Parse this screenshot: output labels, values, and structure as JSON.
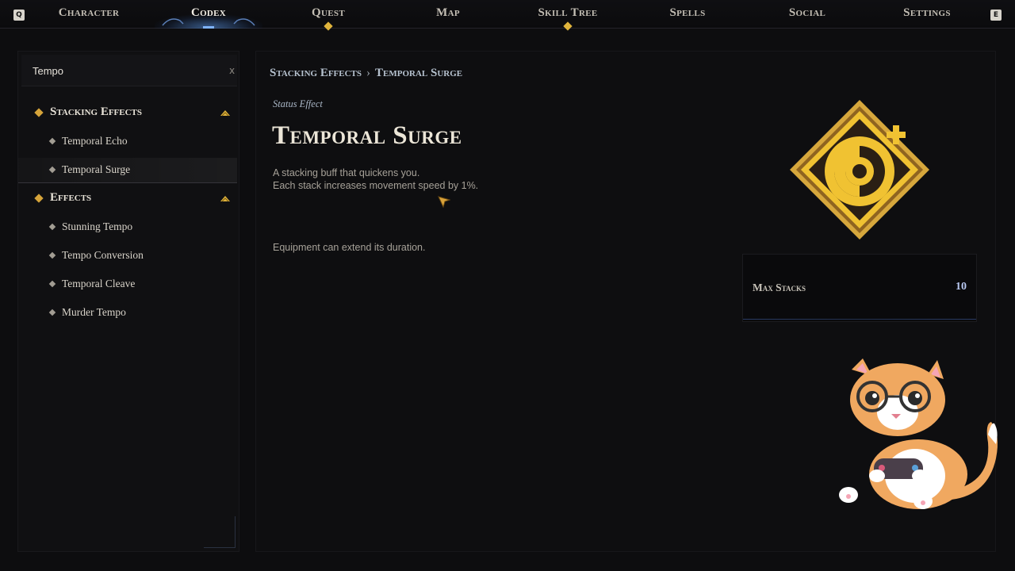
{
  "nav": {
    "key_left": "Q",
    "key_right": "E",
    "tabs": [
      {
        "label": "Character"
      },
      {
        "label": "Codex"
      },
      {
        "label": "Quest"
      },
      {
        "label": "Map"
      },
      {
        "label": "Skill Tree"
      },
      {
        "label": "Spells"
      },
      {
        "label": "Social"
      },
      {
        "label": "Settings"
      }
    ],
    "active_tab": "Codex",
    "tabs_with_notification": [
      "Quest",
      "Skill Tree"
    ]
  },
  "search": {
    "value": "Tempo",
    "clear_label": "x"
  },
  "sidebar": {
    "categories": [
      {
        "label": "Stacking Effects",
        "expanded": true,
        "items": [
          {
            "label": "Temporal Echo"
          },
          {
            "label": "Temporal Surge",
            "selected": true
          }
        ]
      },
      {
        "label": "Effects",
        "expanded": true,
        "items": [
          {
            "label": "Stunning Tempo"
          },
          {
            "label": "Tempo Conversion"
          },
          {
            "label": "Temporal Cleave"
          },
          {
            "label": "Murder Tempo"
          }
        ]
      }
    ]
  },
  "detail": {
    "breadcrumb": [
      "Stacking Effects",
      "Temporal Surge"
    ],
    "breadcrumb_sep": "›",
    "subtype": "Status Effect",
    "title": "Temporal Surge",
    "description_line1": "A stacking buff that quickens you.",
    "description_line2": "Each stack increases movement speed by 1%.",
    "note": "Equipment can extend its duration.",
    "icon": "spiral-rune-icon",
    "stats": [
      {
        "name": "Max Stacks",
        "value": "10"
      }
    ]
  },
  "colors": {
    "accent_gold": "#e0b43c",
    "active_glow": "#7fb4ff",
    "icon_gold": "#f0c232",
    "stat_value": "#b8c8f0"
  }
}
